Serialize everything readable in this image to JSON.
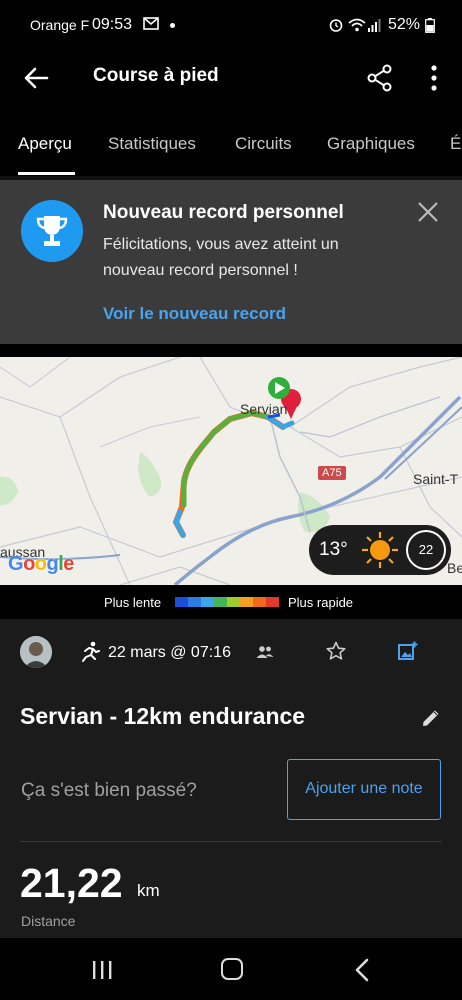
{
  "status_bar": {
    "carrier": "Orange F",
    "time": "09:53",
    "battery": "52%",
    "icons": [
      "mail-icon",
      "alarm-icon",
      "wifi-icon",
      "signal-icon",
      "battery-icon"
    ]
  },
  "app_bar": {
    "title": "Course à pied",
    "icons": [
      "back-arrow-icon",
      "share-icon",
      "more-vert-icon"
    ]
  },
  "tabs": [
    {
      "label": "Aperçu",
      "active": true
    },
    {
      "label": "Statistiques",
      "active": false
    },
    {
      "label": "Circuits",
      "active": false
    },
    {
      "label": "Graphiques",
      "active": false
    },
    {
      "label": "É",
      "active": false
    }
  ],
  "record_banner": {
    "title": "Nouveau record personnel",
    "message": "Félicitations, vous avez atteint un nouveau record personnel !",
    "link": "Voir le nouveau record",
    "icon": "trophy-icon",
    "accent": "#1e9bf0",
    "link_color": "#4aa3ec"
  },
  "map": {
    "labels": [
      "Servian",
      "Saint-T",
      "aussan",
      "Be"
    ],
    "road_badge": "A75",
    "attribution": "Google",
    "weather": {
      "temperature": "13°",
      "icon": "sun-icon",
      "wind": "22"
    }
  },
  "pace_legend": {
    "slow_label": "Plus lente",
    "fast_label": "Plus rapide",
    "colors": [
      "#1c4fd8",
      "#2f7be6",
      "#3aa6e8",
      "#45b35a",
      "#9ccc2e",
      "#f0a020",
      "#f06a1d",
      "#e03a2a"
    ]
  },
  "activity": {
    "date": "22 mars @ 07:16",
    "title": "Servian - 12km endurance",
    "prompt": "Ça s'est bien passé?",
    "note_button": "Ajouter une note",
    "distance": {
      "value": "21,22",
      "unit": "km",
      "label": "Distance"
    }
  }
}
